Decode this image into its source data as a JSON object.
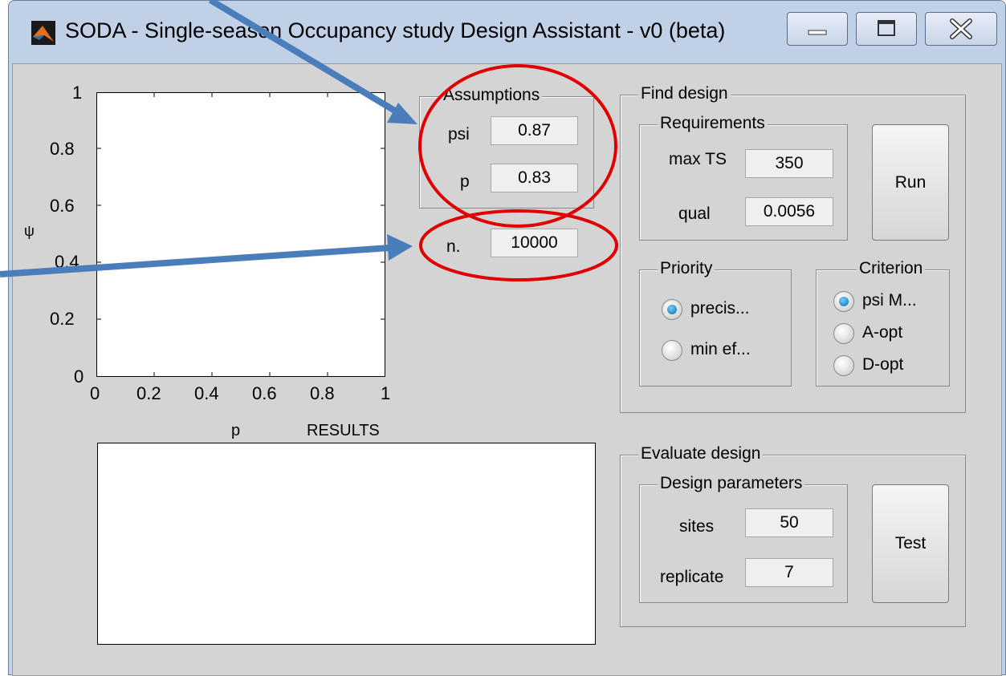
{
  "window": {
    "title": "SODA - Single-season Occupancy study Design Assistant - v0 (beta)"
  },
  "plot": {
    "y_ticks": [
      "1",
      "0.8",
      "0.6",
      "0.4",
      "0.2",
      "0"
    ],
    "x_ticks": [
      "0",
      "0.2",
      "0.4",
      "0.6",
      "0.8",
      "1"
    ],
    "y_label": "ψ",
    "x_label": "p",
    "results_label": "RESULTS"
  },
  "assumptions": {
    "title": "Assumptions",
    "psi_label": "psi",
    "psi_value": "0.87",
    "p_label": "p",
    "p_value": "0.83",
    "n_label": "n.",
    "n_value": "10000"
  },
  "find_design": {
    "title": "Find design",
    "requirements_title": "Requirements",
    "max_ts_label": "max TS",
    "max_ts_value": "350",
    "qual_label": "qual",
    "qual_value": "0.0056",
    "run_label": "Run",
    "priority_title": "Priority",
    "priority_options": [
      "precis...",
      "min ef..."
    ],
    "criterion_title": "Criterion",
    "criterion_options": [
      "psi M...",
      "A-opt",
      "D-opt"
    ]
  },
  "evaluate_design": {
    "title": "Evaluate design",
    "params_title": "Design parameters",
    "sites_label": "sites",
    "sites_value": "50",
    "replicate_label": "replicate",
    "replicate_value": "7",
    "test_label": "Test"
  },
  "colors": {
    "annotation_red": "#e00000",
    "arrow_blue": "#4a7ebb",
    "panel_gray": "#d4d4d4"
  }
}
